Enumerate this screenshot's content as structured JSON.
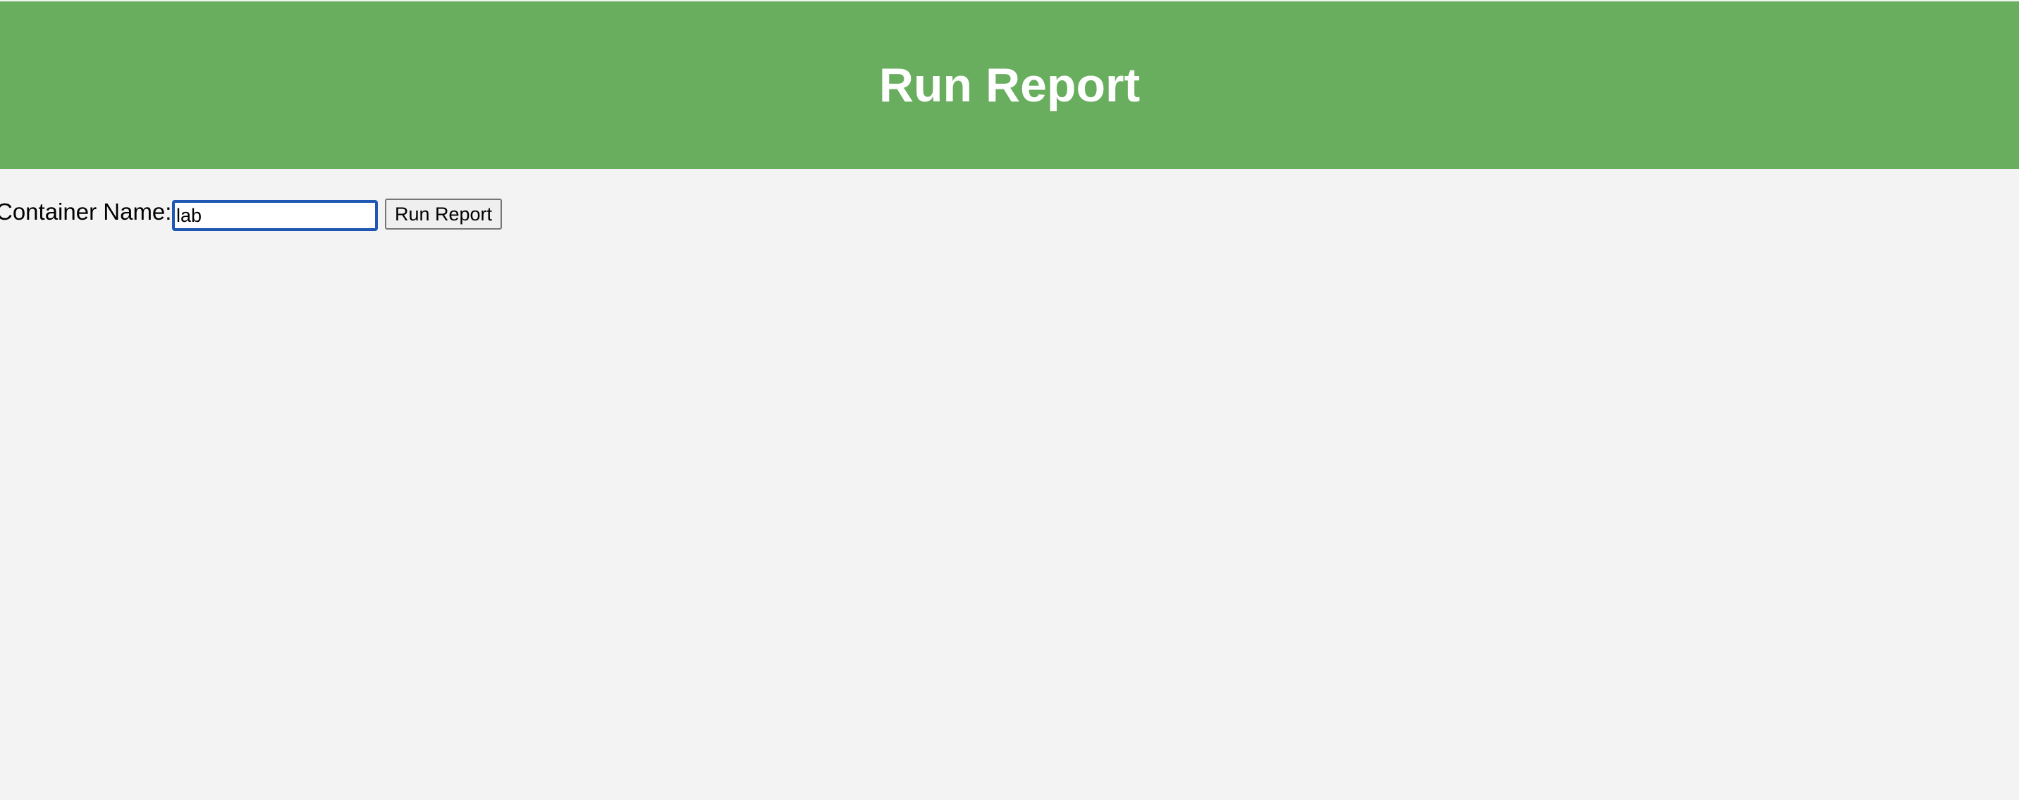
{
  "header": {
    "title": "Run Report",
    "background_color": "#69ae5e",
    "title_color": "#ffffff"
  },
  "form": {
    "container_label": "Container Name:",
    "container_value": "lab",
    "input_focus_color": "#1f57b3",
    "run_button_label": "Run Report"
  },
  "page": {
    "background_color": "#f3f3f3"
  }
}
